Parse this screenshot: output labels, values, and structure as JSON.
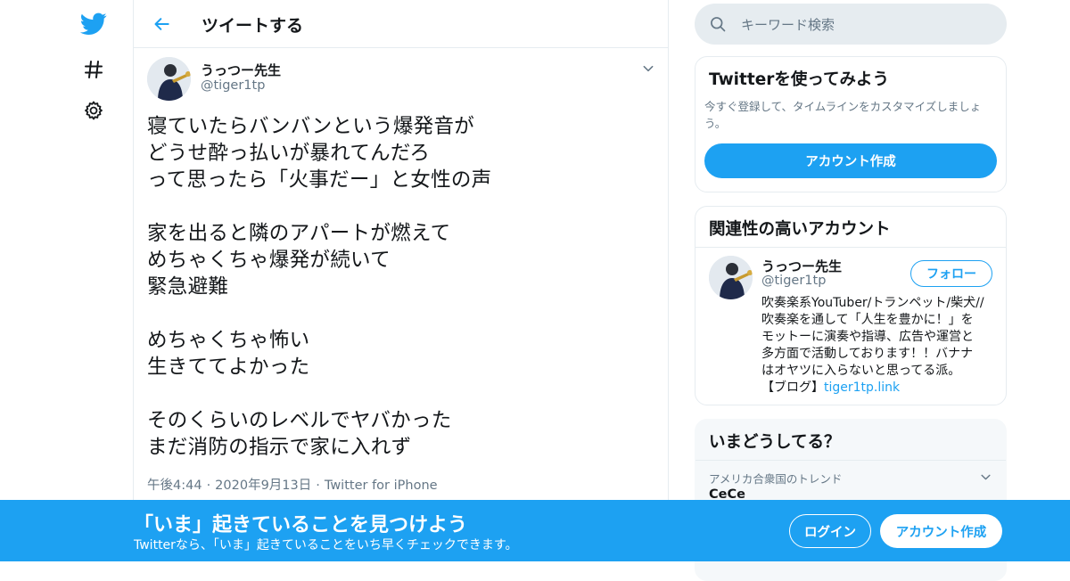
{
  "colors": {
    "accent": "#1da1f2",
    "secondary_text": "#657786",
    "border": "#e6ecf0"
  },
  "nav": {
    "items": [
      {
        "icon": "twitter-logo-icon"
      },
      {
        "icon": "hashtag-icon"
      },
      {
        "icon": "gear-icon"
      }
    ]
  },
  "header": {
    "title": "ツイートする",
    "back_icon": "arrow-left-icon"
  },
  "tweet": {
    "author_name": "うっつー先生",
    "author_handle": "@tiger1tp",
    "text_lines": [
      "寝ていたらバンバンという爆発音が",
      "どうせ酔っ払いが暴れてんだろ",
      "って思ったら「火事だー」と女性の声",
      "",
      "家を出ると隣のアパートが燃えて",
      "めちゃくちゃ爆発が続いて",
      "緊急避難",
      "",
      "めちゃくちゃ怖い",
      "生きててよかった",
      "",
      "そのくらいのレベルでヤバかった",
      "まだ消防の指示で家に入れず"
    ],
    "time": "午後4:44",
    "date": "2020年9月13日",
    "source": "Twitter for iPhone",
    "separator": "·"
  },
  "search": {
    "placeholder": "キーワード検索"
  },
  "signup_card": {
    "title": "Twitterを使ってみよう",
    "description": "今すぐ登録して、タイムラインをカスタマイズしましょう。",
    "button_label": "アカウント作成"
  },
  "related_card": {
    "title": "関連性の高いアカウント",
    "name": "うっつー先生",
    "handle": "@tiger1tp",
    "follow_label": "フォロー",
    "bio_lines": [
      "吹奏楽系YouTuber/トランペット/柴犬//",
      "吹奏楽を通して「人生を豊かに！」を",
      "モットーに演奏や指導、広告や運営と",
      "多方面で活動しております！！バナナ",
      "はオヤツに入らないと思ってる派。"
    ],
    "bio_last_prefix": "【ブログ】",
    "bio_link": "tiger1tp.link"
  },
  "trends_card": {
    "title": "いまどうしてる？",
    "context": "アメリカ合衆国のトレンド",
    "trend_name": "CeCe"
  },
  "bottom_bar": {
    "title": "「いま」起きていることを見つけよう",
    "subtitle": "Twitterなら、「いま」起きていることをいち早くチェックできます。",
    "login_label": "ログイン",
    "signup_label": "アカウント作成"
  }
}
